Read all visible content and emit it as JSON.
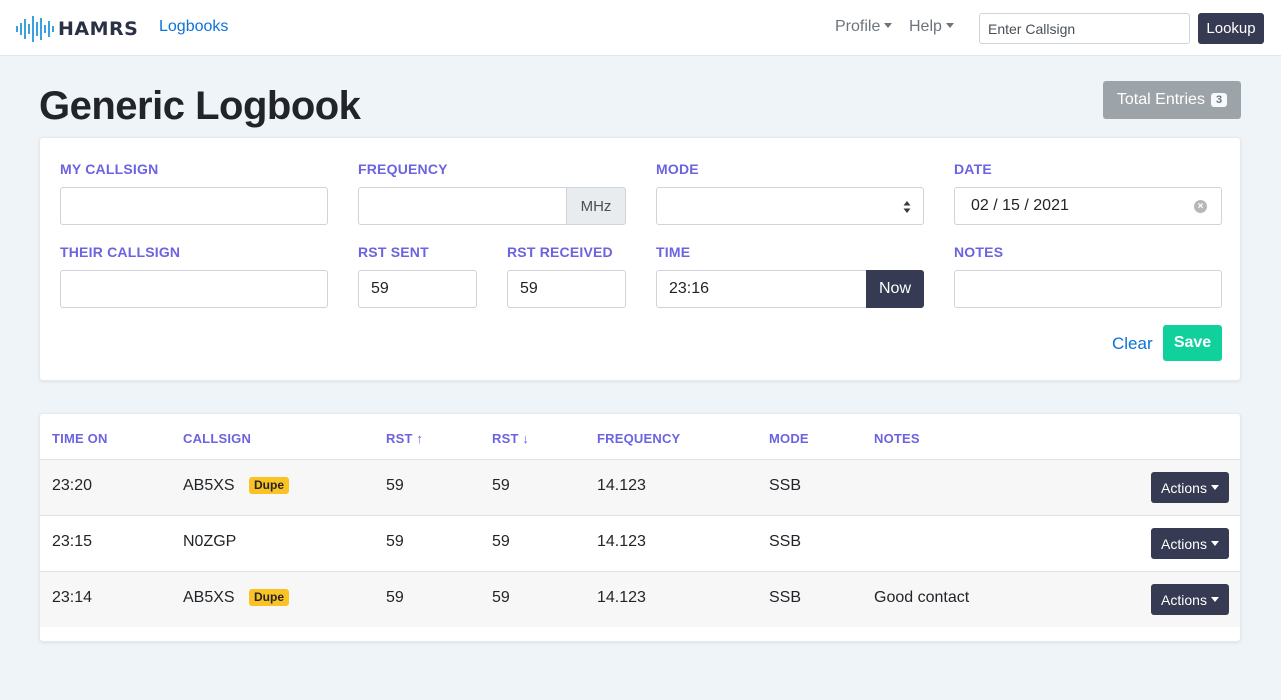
{
  "nav": {
    "brand": "HAMRS",
    "logbooks_link": "Logbooks",
    "profile_menu": "Profile",
    "help_menu": "Help",
    "search_placeholder": "Enter Callsign",
    "lookup_label": "Lookup"
  },
  "page": {
    "title": "Generic Logbook",
    "total_entries_label": "Total Entries",
    "total_entries_count": "3"
  },
  "form": {
    "my_callsign": {
      "label": "MY CALLSIGN",
      "value": ""
    },
    "frequency": {
      "label": "FREQUENCY",
      "value": "",
      "unit": "MHz"
    },
    "mode": {
      "label": "MODE",
      "value": ""
    },
    "date": {
      "label": "DATE",
      "value": "02 / 15 / 2021"
    },
    "their_callsign": {
      "label": "THEIR CALLSIGN",
      "value": ""
    },
    "rst_sent": {
      "label": "RST SENT",
      "value": "59"
    },
    "rst_received": {
      "label": "RST RECEIVED",
      "value": "59"
    },
    "time": {
      "label": "TIME",
      "value": "23:16",
      "now_label": "Now"
    },
    "notes": {
      "label": "NOTES",
      "value": ""
    },
    "clear_label": "Clear",
    "save_label": "Save"
  },
  "table": {
    "columns": [
      "TIME ON",
      "CALLSIGN",
      "RST ↑",
      "RST ↓",
      "FREQUENCY",
      "MODE",
      "NOTES"
    ],
    "dupe_label": "Dupe",
    "actions_label": "Actions",
    "rows": [
      {
        "time_on": "23:20",
        "callsign": "AB5XS",
        "dupe": true,
        "rst_sent": "59",
        "rst_received": "59",
        "frequency": "14.123",
        "mode": "SSB",
        "notes": ""
      },
      {
        "time_on": "23:15",
        "callsign": "N0ZGP",
        "dupe": false,
        "rst_sent": "59",
        "rst_received": "59",
        "frequency": "14.123",
        "mode": "SSB",
        "notes": ""
      },
      {
        "time_on": "23:14",
        "callsign": "AB5XS",
        "dupe": true,
        "rst_sent": "59",
        "rst_received": "59",
        "frequency": "14.123",
        "mode": "SSB",
        "notes": "Good contact"
      }
    ]
  },
  "colors": {
    "accent_label": "#6c63e0",
    "link": "#0d73d6",
    "dark_button": "#363a52",
    "save_button": "#10d19b",
    "dupe_badge": "#fbc224",
    "background": "#eef4f7"
  }
}
